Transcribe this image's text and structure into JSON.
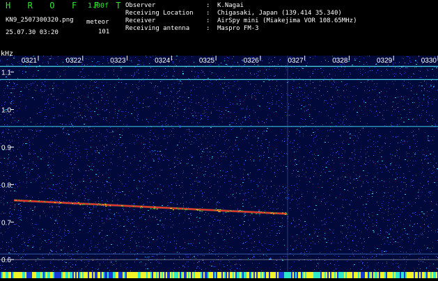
{
  "header": {
    "app_title": "H R O F F T",
    "version": "1.00f",
    "filename": "KN9_2507300320.png",
    "datetime": "25.07.30 03:20",
    "mode": "meteor",
    "count": "101"
  },
  "info": [
    {
      "key": "Observer",
      "value": "K.Nagai"
    },
    {
      "key": "Receiving Location",
      "value": "Chigasaki, Japan (139.414 35.340)"
    },
    {
      "key": "Receiver",
      "value": "AirSpy mini (Miakejima VOR 108.65MHz)"
    },
    {
      "key": "Receiving antenna",
      "value": "Maspro FM-3"
    }
  ],
  "axis": {
    "unit": "kHz",
    "time_labels": [
      "0321",
      "0322",
      "0323",
      "0324",
      "0325",
      "0326",
      "0327",
      "0328",
      "0329",
      "0330"
    ],
    "freq_labels": [
      "1.1",
      "1.0",
      "0.9",
      "0.8",
      "0.7",
      "0.6"
    ],
    "freq_range": [
      0.58,
      1.14
    ]
  },
  "colors": {
    "background": "#000000",
    "noise_blue": "#1a3bd6",
    "noise_cyan": "#22c8e8",
    "trace_cyan": "#3ee6f0",
    "meteor_red": "#ff2a2a",
    "title_green": "#2ee82e",
    "bottom_yellow": "#f3f32a"
  }
}
